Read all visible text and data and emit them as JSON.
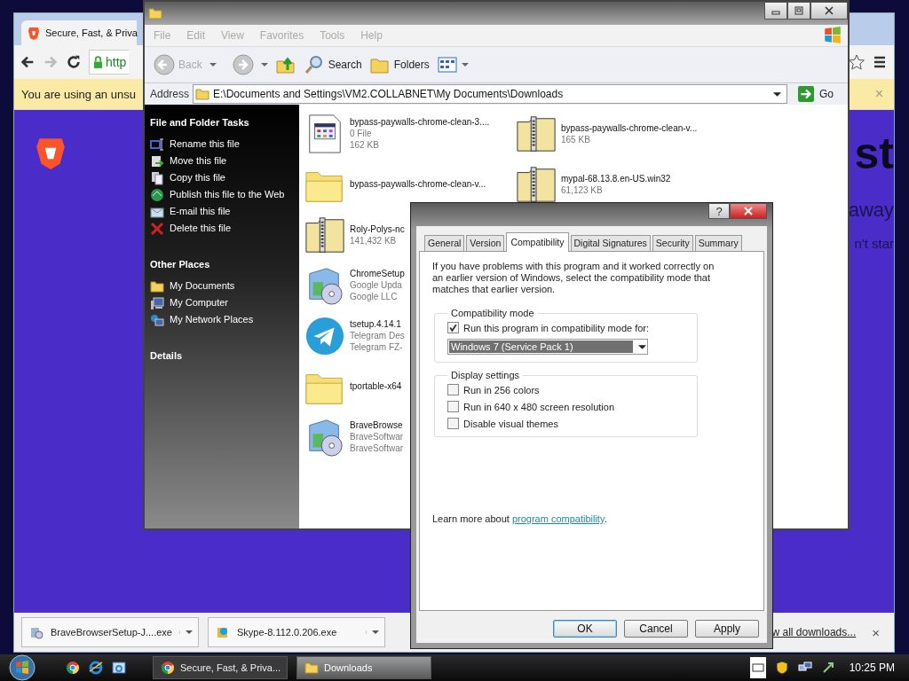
{
  "browser": {
    "tab_title": "Secure, Fast, & Priva",
    "url": "http",
    "warning": "You are using an unsu",
    "warning_close": "×",
    "page_texts": [
      "st",
      "away",
      "n't star"
    ],
    "downloads": [
      {
        "name": "BraveBrowserSetup-J....exe",
        "kind": "installer"
      },
      {
        "name": "Skype-8.112.0.206.exe",
        "kind": "skype"
      }
    ],
    "show_all": "w all downloads...",
    "shelf_close": "×"
  },
  "explorer": {
    "menu": [
      "File",
      "Edit",
      "View",
      "Favorites",
      "Tools",
      "Help"
    ],
    "menu_disabled": true,
    "toolbar": {
      "back": "Back",
      "back_disabled": true,
      "search": "Search",
      "folders": "Folders"
    },
    "address_label": "Address",
    "address": "E:\\Documents and Settings\\VM2.COLLABNET\\My Documents\\Downloads",
    "go": "Go",
    "task_sections": [
      {
        "title": "File and Folder Tasks",
        "items": [
          "Rename this file",
          "Move this file",
          "Copy this file",
          "Publish this file to the Web",
          "E-mail this file",
          "Delete this file"
        ]
      },
      {
        "title": "Other Places",
        "items": [
          "My Documents",
          "My Computer",
          "My Network Places"
        ]
      },
      {
        "title": "Details"
      }
    ],
    "files": [
      {
        "kind": "settings",
        "lines": [
          "bypass-paywalls-chrome-clean-3....",
          "0 File",
          "162 KB"
        ]
      },
      {
        "kind": "zip",
        "lines": [
          "bypass-paywalls-chrome-clean-v...",
          "165 KB"
        ]
      },
      {
        "kind": "folder",
        "lines": [
          "bypass-paywalls-chrome-clean-v..."
        ]
      },
      {
        "kind": "zip",
        "lines": [
          "mypal-68.13.8.en-US.win32",
          "61,123 KB"
        ]
      },
      {
        "kind": "zip",
        "lines": [
          "Roly-Polys-nc",
          "141,432 KB"
        ]
      },
      {
        "kind": "installer",
        "lines": [
          "ChromeSetup",
          "Google Upda",
          "Google LLC"
        ]
      },
      {
        "kind": "telegram",
        "lines": [
          "tsetup.4.14.1",
          "Telegram Des",
          "Telegram FZ-"
        ]
      },
      {
        "kind": "folder",
        "lines": [
          "tportable-x64"
        ]
      },
      {
        "kind": "installer",
        "lines": [
          "BraveBrowse",
          "BraveSoftwar",
          "BraveSoftwar"
        ]
      }
    ]
  },
  "dialog": {
    "help": "?",
    "tabs": [
      {
        "label": "General",
        "selected": false
      },
      {
        "label": "Version",
        "selected": false
      },
      {
        "label": "Compatibility",
        "selected": true
      },
      {
        "label": "Digital Signatures",
        "selected": false
      },
      {
        "label": "Security",
        "selected": false
      },
      {
        "label": "Summary",
        "selected": false
      }
    ],
    "intro": "If you have problems with this program and it worked correctly on an earlier version of Windows, select the compatibility mode that matches that earlier version.",
    "mode_group": "Compatibility mode",
    "mode_check": {
      "label": "Run this program in compatibility mode for:",
      "checked": true
    },
    "mode_value": "Windows 7 (Service Pack 1)",
    "display_group": "Display settings",
    "display_checks": [
      {
        "label": "Run in 256 colors",
        "checked": false
      },
      {
        "label": "Run in 640 x 480 screen resolution",
        "checked": false
      },
      {
        "label": "Disable visual themes",
        "checked": false
      }
    ],
    "learn_prefix": "Learn more about ",
    "learn_link": "program compatibility",
    "learn_suffix": ".",
    "buttons": [
      {
        "label": "OK",
        "default": true
      },
      {
        "label": "Cancel",
        "default": false
      },
      {
        "label": "Apply",
        "default": false
      }
    ]
  },
  "taskbar": {
    "tasks": [
      {
        "label": "Secure, Fast, & Priva...",
        "kind": "chrome",
        "selected": false
      },
      {
        "label": "Downloads",
        "kind": "folder",
        "selected": true
      }
    ],
    "time": "10:25 PM"
  }
}
